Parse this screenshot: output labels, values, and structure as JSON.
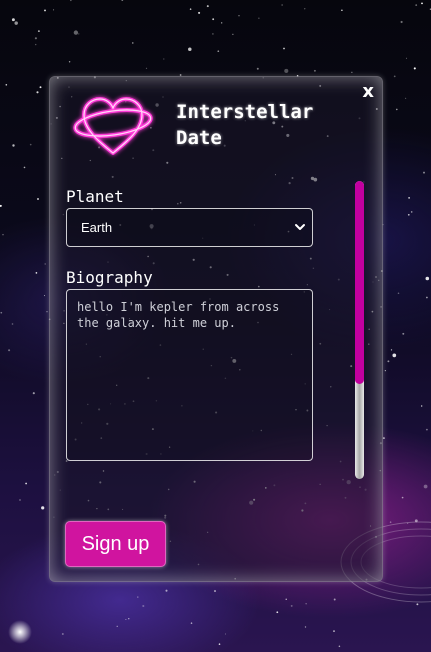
{
  "app": {
    "title": "Interstellar Date"
  },
  "modal": {
    "close_label": "x"
  },
  "form": {
    "planet_label": "Planet",
    "planet_value": "Earth",
    "bio_label": "Biography",
    "bio_value": "hello I'm kepler from across\nthe galaxy. hit me up.",
    "signup_label": "Sign up"
  },
  "scroll": {
    "position_fraction": 0.0,
    "visible_fraction": 0.68
  },
  "colors": {
    "accent": "#d0149f",
    "logo_glow": "#ff2ad4"
  },
  "icons": {
    "logo": "heart-planet-logo-icon",
    "select": "chevron-down-icon"
  }
}
